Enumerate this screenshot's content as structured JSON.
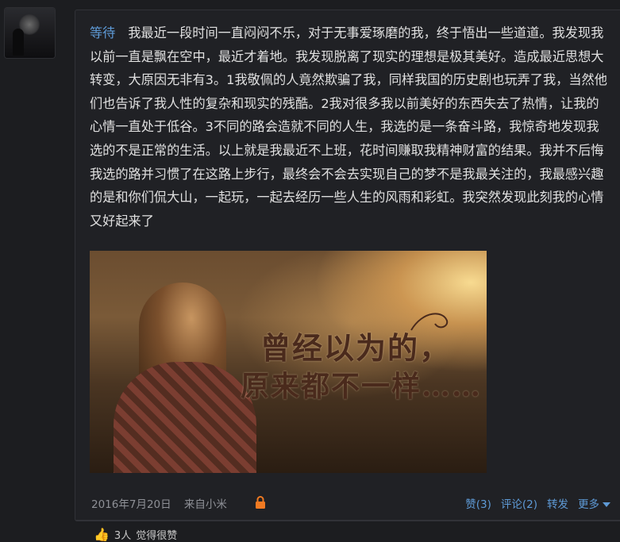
{
  "post": {
    "username": "等待",
    "body": "我最近一段时间一直闷闷不乐，对于无事爱琢磨的我，终于悟出一些道道。我发现我以前一直是飘在空中，最近才着地。我发现脱离了现实的理想是极其美好。造成最近思想大转变，大原因无非有3。1我敬佩的人竟然欺骗了我，同样我国的历史剧也玩弄了我，当然他们也告诉了我人性的复杂和现实的残酷。2我对很多我以前美好的东西失去了热情，让我的心情一直处于低谷。3不同的路会造就不同的人生，我选的是一条奋斗路，我惊奇地发现我选的不是正常的生活。以上就是我最近不上班，花时间赚取我精神财富的结果。我并不后悔我选的路并习惯了在这路上步行，最终会不会去实现自己的梦不是我最关注的，我最感兴趣的是和你们侃大山，一起玩，一起去经历一些人生的风雨和彩虹。我突然发现此刻我的心情又好起来了",
    "image_text_line1": "曾经以为的，",
    "image_text_line2": "原来都不一样……",
    "date": "2016年7月20日",
    "source": "来自小米",
    "icons": {
      "lock": "lock-icon",
      "thumb": "thumbs-up-icon",
      "more": "chevron-down-icon"
    },
    "colors": {
      "link": "#5e9ad6",
      "lock": "#f07a22"
    }
  },
  "actions": {
    "like_label": "赞(3)",
    "comment_label": "评论(2)",
    "share_label": "转发",
    "more_label": "更多"
  },
  "like_strip": {
    "count": "3人",
    "text": "觉得很赞"
  }
}
